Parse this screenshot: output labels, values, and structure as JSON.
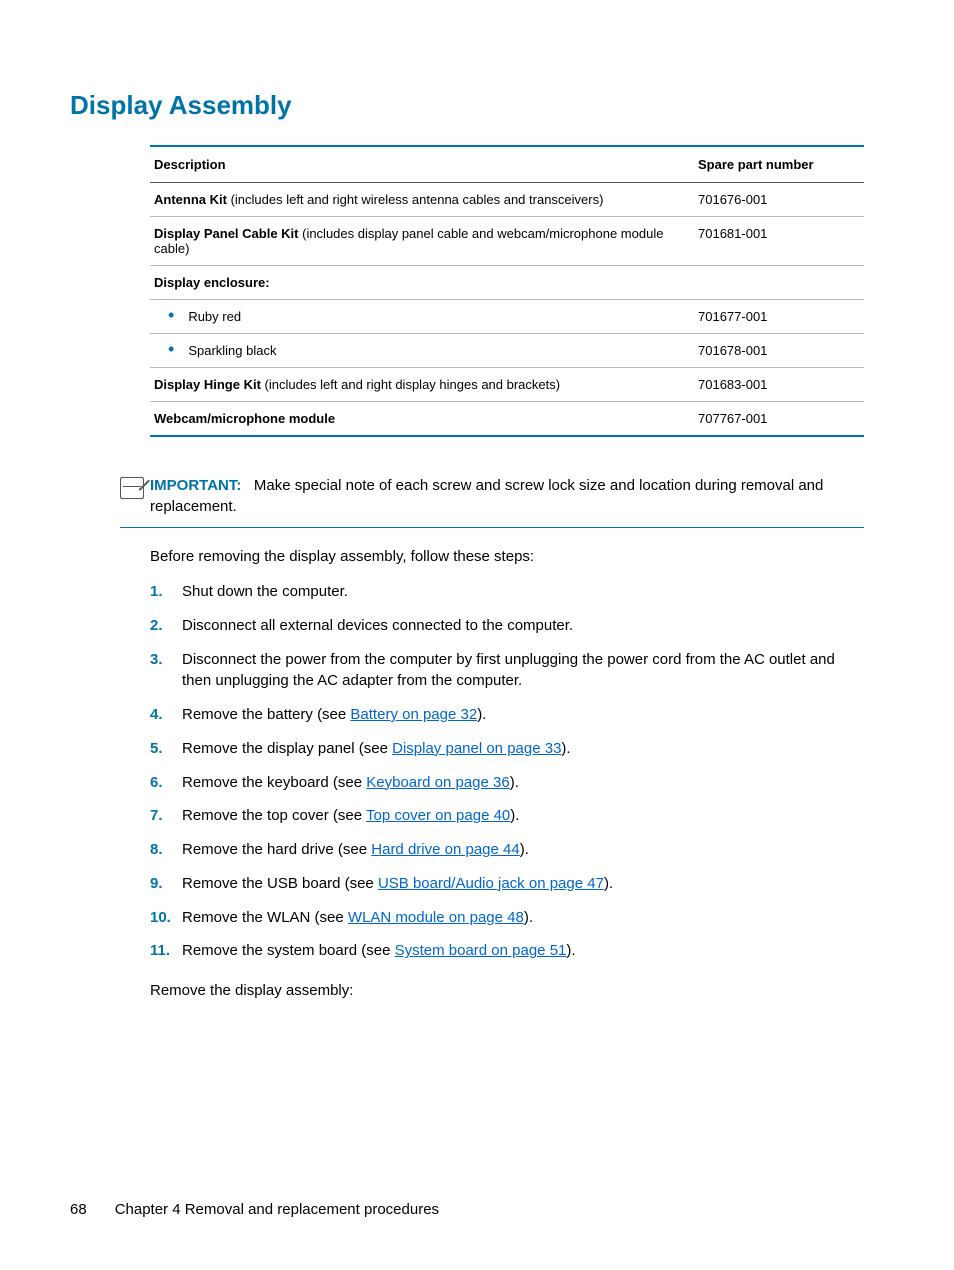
{
  "heading": "Display Assembly",
  "table": {
    "headers": {
      "desc": "Description",
      "spn": "Spare part number"
    },
    "rows": [
      {
        "bold": "Antenna Kit",
        "rest": " (includes left and right wireless antenna cables and transceivers)",
        "spn": "701676-001",
        "bullet": false
      },
      {
        "bold": "Display Panel Cable Kit",
        "rest": " (includes display panel cable and webcam/microphone module cable)",
        "spn": "701681-001",
        "bullet": false
      },
      {
        "bold": "Display enclosure:",
        "rest": "",
        "spn": "",
        "bullet": false
      },
      {
        "bold": "",
        "rest": "Ruby red",
        "spn": "701677-001",
        "bullet": true
      },
      {
        "bold": "",
        "rest": "Sparkling black",
        "spn": "701678-001",
        "bullet": true
      },
      {
        "bold": "Display Hinge Kit",
        "rest": " (includes left and right display hinges and brackets)",
        "spn": "701683-001",
        "bullet": false
      },
      {
        "bold": "Webcam/microphone module",
        "rest": "",
        "spn": "707767-001",
        "bullet": false
      }
    ]
  },
  "important": {
    "label": "IMPORTANT:",
    "text": "Make special note of each screw and screw lock size and location during removal and replacement."
  },
  "intro": "Before removing the display assembly, follow these steps:",
  "steps": [
    {
      "n": "1.",
      "pre": "Shut down the computer.",
      "link": "",
      "post": ""
    },
    {
      "n": "2.",
      "pre": "Disconnect all external devices connected to the computer.",
      "link": "",
      "post": ""
    },
    {
      "n": "3.",
      "pre": "Disconnect the power from the computer by first unplugging the power cord from the AC outlet and then unplugging the AC adapter from the computer.",
      "link": "",
      "post": ""
    },
    {
      "n": "4.",
      "pre": "Remove the battery (see ",
      "link": "Battery on page 32",
      "post": ")."
    },
    {
      "n": "5.",
      "pre": "Remove the display panel (see ",
      "link": "Display panel on page 33",
      "post": ")."
    },
    {
      "n": "6.",
      "pre": "Remove the keyboard (see ",
      "link": "Keyboard on page 36",
      "post": ")."
    },
    {
      "n": "7.",
      "pre": "Remove the top cover (see ",
      "link": "Top cover on page 40",
      "post": ")."
    },
    {
      "n": "8.",
      "pre": "Remove the hard drive (see ",
      "link": "Hard drive on page 44",
      "post": ")."
    },
    {
      "n": "9.",
      "pre": "Remove the USB board (see ",
      "link": "USB board/Audio jack on page 47",
      "post": ")."
    },
    {
      "n": "10.",
      "pre": "Remove the WLAN (see ",
      "link": "WLAN module on page 48",
      "post": ")."
    },
    {
      "n": "11.",
      "pre": "Remove the system board (see ",
      "link": "System board on page 51",
      "post": ")."
    }
  ],
  "outro": "Remove the display assembly:",
  "footer": {
    "page": "68",
    "chapter": "Chapter 4   Removal and replacement procedures"
  }
}
